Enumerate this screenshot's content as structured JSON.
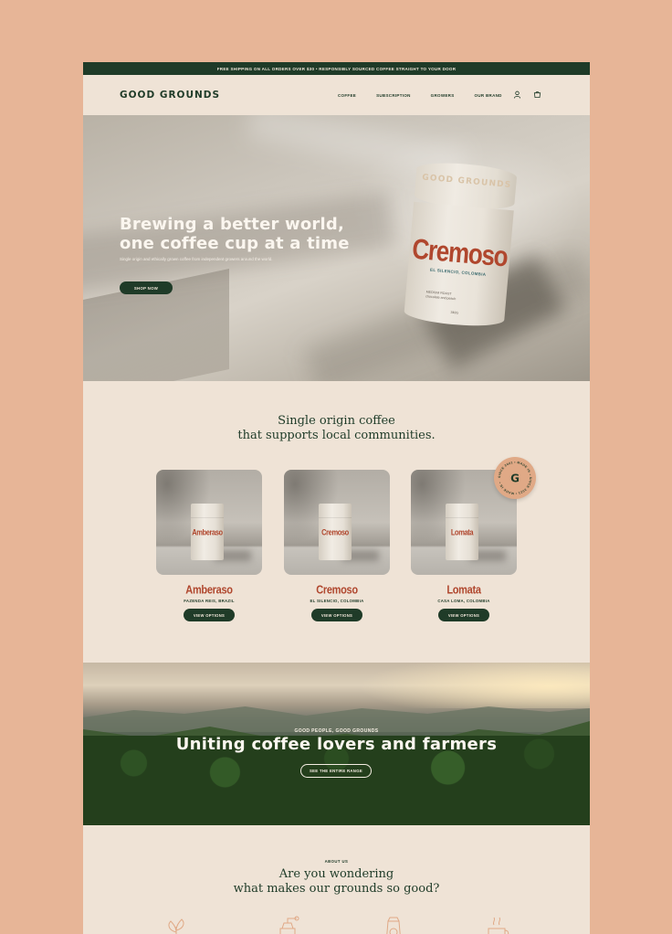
{
  "announcement": "FREE SHIPPING ON ALL ORDERS OVER $30 • RESPONSIBLY SOURCED COFFEE STRAIGHT TO YOUR DOOR",
  "brand": "GOOD GROUNDS",
  "nav": [
    "COFFEE",
    "SUBSCRIPTION",
    "GROWERS",
    "OUR BRAND"
  ],
  "header_icons": [
    "user-icon",
    "cart-icon"
  ],
  "hero": {
    "title_line1": "Brewing a better world,",
    "title_line2": "one coffee cup at a time",
    "subtitle": "Single origin and ethically grown coffee from independent growers around the world.",
    "cta": "SHOP NOW",
    "can": {
      "lid_text": "GOOD GROUNDS",
      "name": "Cremoso",
      "origin": "EL SILENCIO, COLOMBIA",
      "roast_line1": "MEDIUM ROAST",
      "roast_line2": "chocolate and peach",
      "weight": "340G"
    }
  },
  "products_section": {
    "title_line1": "Single origin coffee",
    "title_line2": "that supports local communities.",
    "items": [
      {
        "name": "Amberaso",
        "origin": "FAZENDA REIS, BRAZIL",
        "button": "VIEW OPTIONS"
      },
      {
        "name": "Cremoso",
        "origin": "EL SILENCIO, COLOMBIA",
        "button": "VIEW OPTIONS"
      },
      {
        "name": "Lomata",
        "origin": "CASA LOMA, COLOMBIA",
        "button": "VIEW OPTIONS"
      }
    ],
    "badge": {
      "letter": "G",
      "ring_text": "SINCE 2021 • MADE IN • SINCE 2021 • MADE IN •"
    }
  },
  "banner": {
    "eyebrow": "GOOD PEOPLE, GOOD GROUNDS",
    "title": "Uniting coffee lovers and farmers",
    "cta": "SEE THE ENTIRE RANGE"
  },
  "about": {
    "eyebrow": "ABOUT US",
    "title_line1": "Are you wondering",
    "title_line2": "what makes our grounds so good?"
  },
  "colors": {
    "page_background": "#e7b597",
    "cream": "#efe3d6",
    "dark_green": "#1f3b28",
    "rust": "#b0472e",
    "badge": "#e0a986"
  }
}
